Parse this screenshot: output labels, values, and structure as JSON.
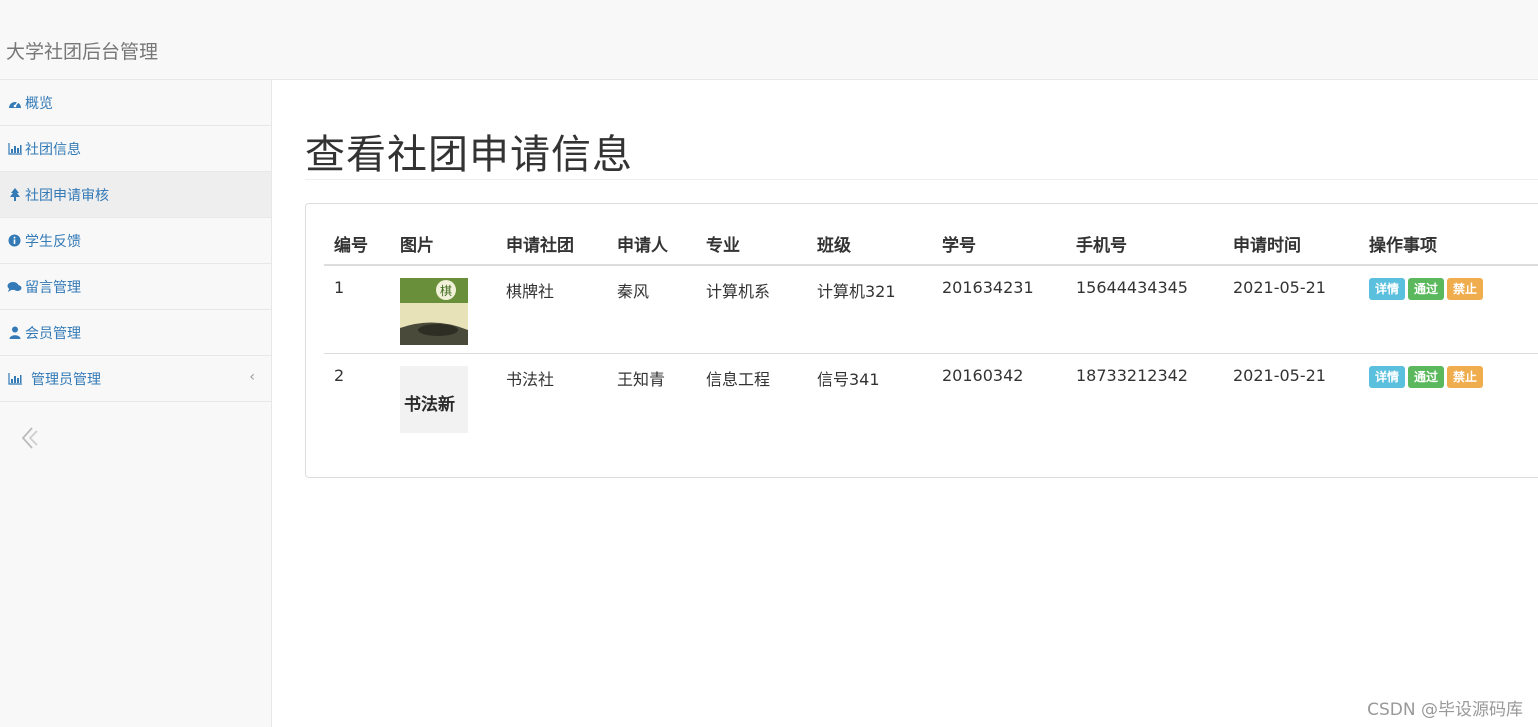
{
  "header": {
    "brand": "大学社团后台管理"
  },
  "sidebar": {
    "items": [
      {
        "label": "概览",
        "icon": "dashboard-icon"
      },
      {
        "label": "社团信息",
        "icon": "bar-chart-icon"
      },
      {
        "label": "社团申请审核",
        "icon": "tree-icon",
        "active": true
      },
      {
        "label": "学生反馈",
        "icon": "info-circle-icon"
      },
      {
        "label": "留言管理",
        "icon": "comments-icon"
      },
      {
        "label": "会员管理",
        "icon": "user-icon"
      },
      {
        "label": "管理员管理",
        "icon": "bar-chart-icon",
        "expandable": true
      }
    ]
  },
  "main": {
    "title": "查看社团申请信息",
    "table": {
      "headers": [
        "编号",
        "图片",
        "申请社团",
        "申请人",
        "专业",
        "班级",
        "学号",
        "手机号",
        "申请时间",
        "操作事项"
      ],
      "rows": [
        {
          "id": "1",
          "club": "棋牌社",
          "applicant": "秦风",
          "major": "计算机系",
          "class": "计算机321",
          "student_no": "201634231",
          "phone": "15644434345",
          "date": "2021-05-21",
          "image": "chess-club-thumbnail"
        },
        {
          "id": "2",
          "club": "书法社",
          "applicant": "王知青",
          "major": "信息工程",
          "class": "信号341",
          "student_no": "20160342",
          "phone": "18733212342",
          "date": "2021-05-21",
          "image": "calligraphy-club-thumbnail"
        }
      ],
      "actions": {
        "detail": "详情",
        "approve": "通过",
        "ban": "禁止"
      }
    }
  },
  "watermark": "CSDN @毕设源码库",
  "colors": {
    "link": "#337ab7",
    "info": "#5bc0de",
    "success": "#5cb85c",
    "warning": "#f0ad4e"
  }
}
